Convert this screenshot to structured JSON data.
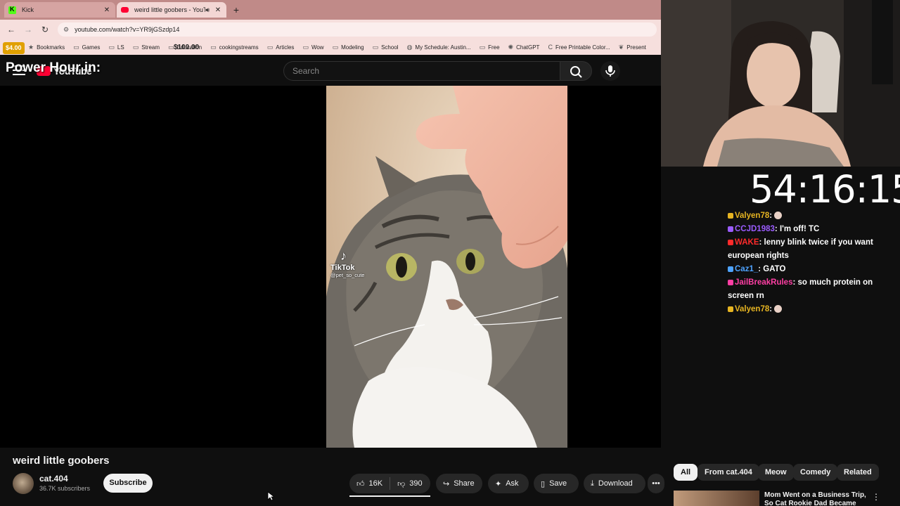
{
  "browser": {
    "tabs": [
      {
        "label": "Kick",
        "icon": "kick-icon"
      },
      {
        "label": "weird little goobers - YouTube",
        "icon": "youtube-icon"
      }
    ],
    "url": "youtube.com/watch?v=YR9jGSzdp14",
    "bookmarks": [
      {
        "label": "Bookmarks",
        "icon": "star-icon"
      },
      {
        "label": "Games",
        "icon": "folder-icon"
      },
      {
        "label": "LS",
        "icon": "folder-icon"
      },
      {
        "label": "Stream",
        "icon": "folder-icon"
      },
      {
        "label": "Education",
        "icon": "folder-icon"
      },
      {
        "label": "cookingstreams",
        "icon": "folder-icon"
      },
      {
        "label": "Articles",
        "icon": "folder-icon"
      },
      {
        "label": "Wow",
        "icon": "folder-icon"
      },
      {
        "label": "Modeling",
        "icon": "folder-icon"
      },
      {
        "label": "School",
        "icon": "folder-icon"
      },
      {
        "label": "My Schedule: Austin...",
        "icon": "globe-icon"
      },
      {
        "label": "Free",
        "icon": "folder-icon"
      },
      {
        "label": "ChatGPT",
        "icon": "chatgpt-icon"
      },
      {
        "label": "Free Printable Color...",
        "icon": "c-icon"
      },
      {
        "label": "Present",
        "icon": "leaf-icon"
      }
    ]
  },
  "overlay": {
    "money_badge": "$4.00",
    "money_badge2": "$100.00",
    "power_hour": "Power Hour in:",
    "timer": "54:16:15"
  },
  "youtube": {
    "logo_text": "YouTube",
    "search_placeholder": "Search",
    "video_title": "weird little goobers",
    "watermark_brand": "TikTok",
    "watermark_handle": "@pet_so_cute",
    "channel": {
      "name": "cat.404",
      "subscribers": "36.7K subscribers",
      "subscribe_label": "Subscribe"
    },
    "actions": {
      "likes": "16K",
      "dislikes": "390",
      "share": "Share",
      "ask": "Ask",
      "save": "Save",
      "download": "Download"
    },
    "chips": [
      "All",
      "From cat.404",
      "Meow",
      "Comedy",
      "Related"
    ],
    "recommendation": {
      "title": "Mom Went on a Business Trip, So Cat Rookie Dad Became th..."
    }
  },
  "chat": [
    {
      "user": "Valyen78",
      "color": "#e6b422",
      "message": ""
    },
    {
      "user": "CCJD1983",
      "color": "#9b5cff",
      "message": "I'm off! TC"
    },
    {
      "user": "WAKE",
      "color": "#ff2b2b",
      "message": "lenny blink twice if you want european rights"
    },
    {
      "user": "Caz1_",
      "color": "#4ea3ff",
      "message": "GATO"
    },
    {
      "user": "JailBreakRules",
      "color": "#ff3fa4",
      "message": "so much protein on screen rn"
    },
    {
      "user": "Valyen78",
      "color": "#e6b422",
      "message": ""
    }
  ]
}
